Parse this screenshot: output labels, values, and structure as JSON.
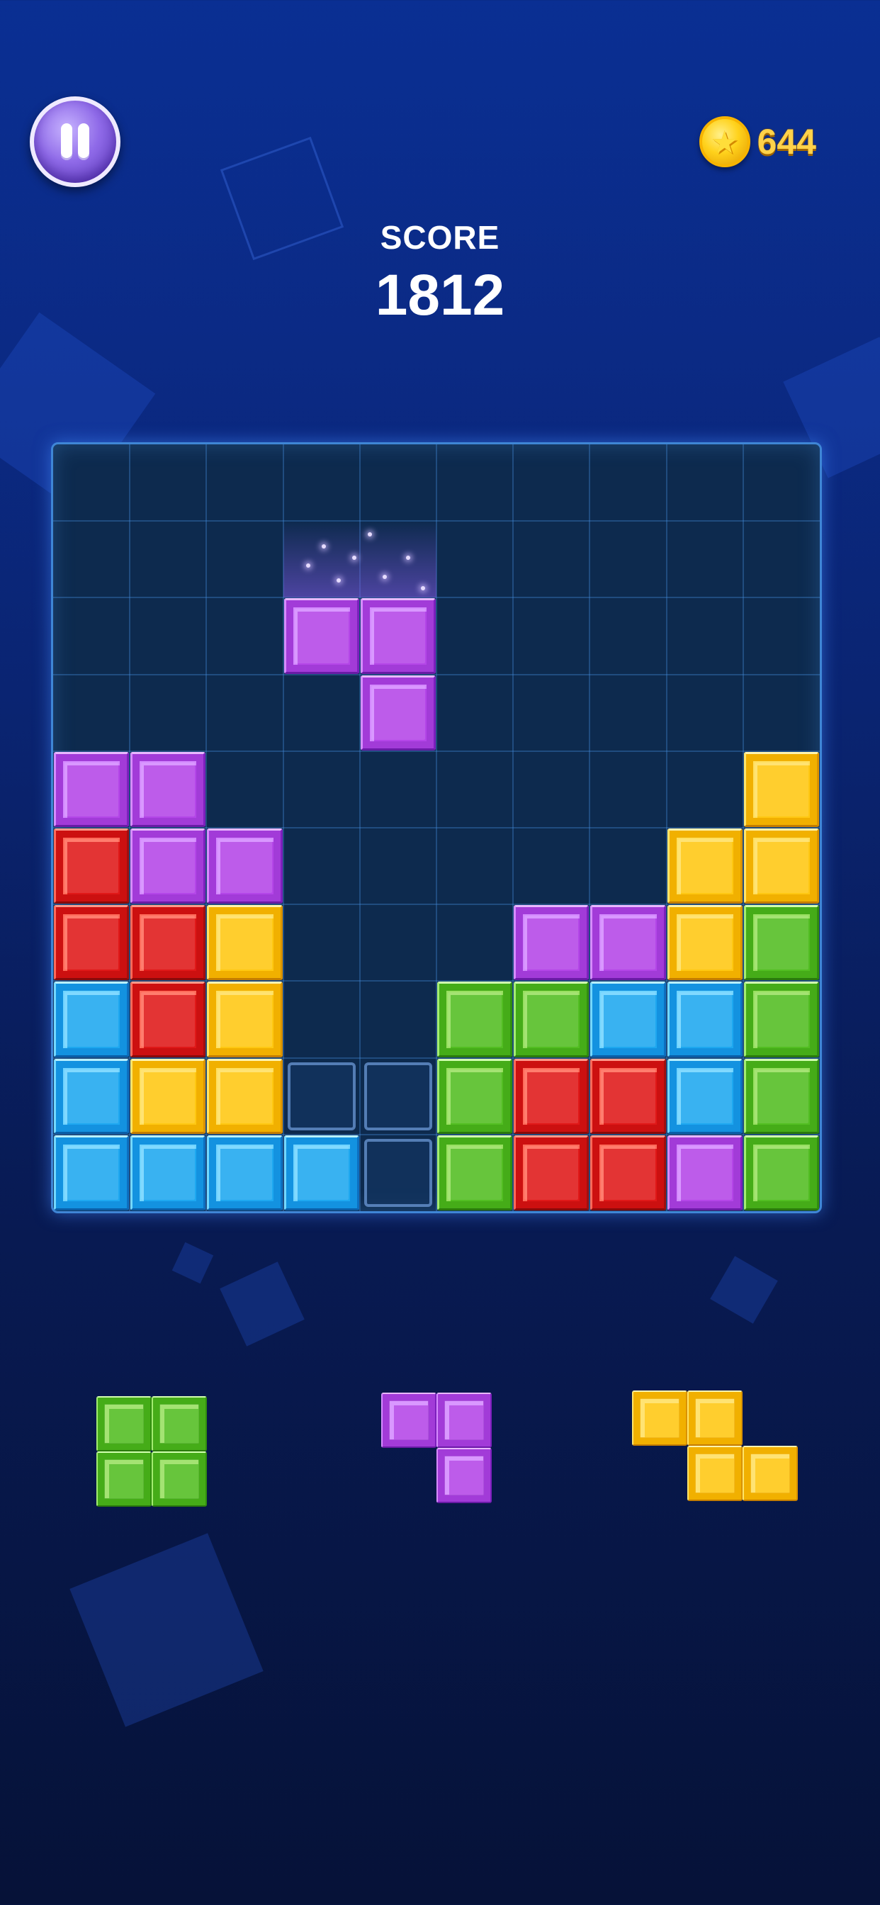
{
  "header": {
    "pause_icon": "pause-icon",
    "coin_icon": "coin-star-icon",
    "coins": "644",
    "score_label": "SCORE",
    "score": "1812"
  },
  "colors": {
    "purple": "#b446e8",
    "red": "#e01818",
    "yellow": "#ffc812",
    "cyan": "#1ea8f0",
    "green": "#52be22",
    "board_bg": "#0d2a4e",
    "board_border": "#3f86d6"
  },
  "board": {
    "cols": 10,
    "rows": 10,
    "cells": [
      [
        "",
        "",
        "",
        "",
        "",
        "",
        "",
        "",
        "",
        ""
      ],
      [
        "",
        "",
        "",
        "",
        "",
        "",
        "",
        "",
        "",
        ""
      ],
      [
        "",
        "",
        "",
        "purple",
        "purple",
        "",
        "",
        "",
        "",
        ""
      ],
      [
        "",
        "",
        "",
        "",
        "purple",
        "",
        "",
        "",
        "",
        ""
      ],
      [
        "purple",
        "purple",
        "",
        "",
        "",
        "",
        "",
        "",
        "",
        "yellow"
      ],
      [
        "red",
        "purple",
        "purple",
        "",
        "",
        "",
        "",
        "",
        "yellow",
        "yellow"
      ],
      [
        "red",
        "red",
        "yellow",
        "",
        "",
        "",
        "purple",
        "purple",
        "yellow",
        "green"
      ],
      [
        "cyan",
        "red",
        "yellow",
        "",
        "",
        "green",
        "green",
        "cyan",
        "cyan",
        "green"
      ],
      [
        "cyan",
        "yellow",
        "yellow",
        "ghost",
        "ghost",
        "green",
        "red",
        "red",
        "cyan",
        "green"
      ],
      [
        "cyan",
        "cyan",
        "cyan",
        "cyan",
        "ghost",
        "green",
        "red",
        "red",
        "purple",
        "green"
      ]
    ]
  },
  "tray": [
    {
      "color": "green",
      "cells": [
        [
          1,
          1
        ],
        [
          1,
          1
        ]
      ]
    },
    {
      "color": "purple",
      "cells": [
        [
          1,
          1
        ],
        [
          0,
          1
        ]
      ]
    },
    {
      "color": "yellow",
      "cells": [
        [
          1,
          1,
          0
        ],
        [
          0,
          1,
          1
        ]
      ]
    }
  ]
}
